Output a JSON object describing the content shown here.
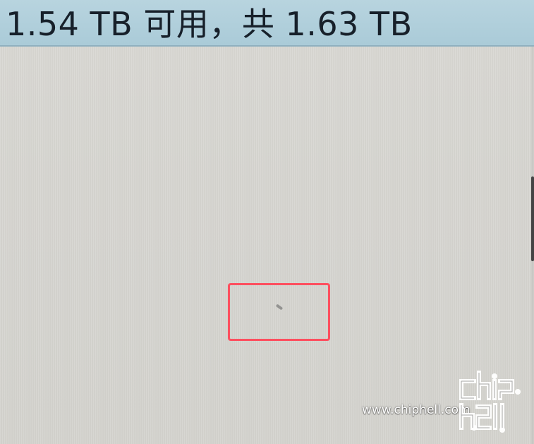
{
  "status_bar": {
    "text": "1.54 TB 可用，共 1.63 TB"
  },
  "watermark": {
    "url": "www.chiphell.com",
    "logo_text": "chiphell"
  },
  "colors": {
    "status_bar_bg": "#b0cfdb",
    "content_bg": "#d6d5d0",
    "highlight_border": "#ff4f5f",
    "watermark_text": "#ffffff"
  },
  "icons": {
    "logo": "chiphell-logo-icon"
  }
}
